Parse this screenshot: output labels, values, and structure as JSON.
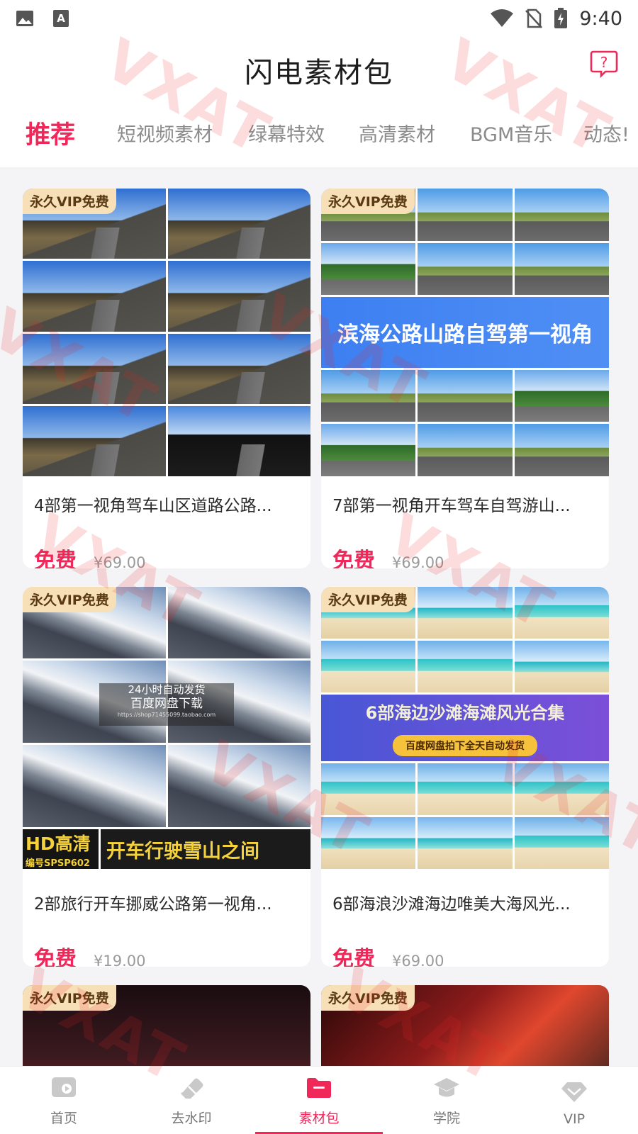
{
  "status_bar": {
    "time": "9:40",
    "icons": [
      "image-icon",
      "text-a-icon",
      "wifi-icon",
      "no-sim-icon",
      "battery-charging-icon"
    ]
  },
  "header": {
    "title": "闪电素材包",
    "help_icon": "question-bubble-icon"
  },
  "tabs": [
    {
      "label": "推荐",
      "active": true
    },
    {
      "label": "短视频素材",
      "active": false
    },
    {
      "label": "绿幕特效",
      "active": false
    },
    {
      "label": "高清素材",
      "active": false
    },
    {
      "label": "BGM音乐",
      "active": false
    },
    {
      "label": "动态!",
      "active": false
    }
  ],
  "cards": [
    {
      "badge": "永久VIP免费",
      "title": "4部第一视角驾车山区道路公路...",
      "price_label": "免费",
      "original_price": "¥69.00"
    },
    {
      "badge": "永久VIP免费",
      "banner_text": "滨海公路山路自驾第一视角",
      "title": "7部第一视角开车驾车自驾游山...",
      "price_label": "免费",
      "original_price": "¥69.00"
    },
    {
      "badge": "永久VIP免费",
      "overlay": [
        "24小时自动发货",
        "百度网盘下载",
        "https://shop71455099.taobao.com"
      ],
      "hd_big": "HD高清",
      "hd_code": "编号SPSP602",
      "hd_caption": "开车行驶雪山之间",
      "title": "2部旅行开车挪威公路第一视角...",
      "price_label": "免费",
      "original_price": "¥19.00"
    },
    {
      "badge": "永久VIP免费",
      "banner_text": "6部海边沙滩海滩风光合集",
      "banner_pill": "百度网盘拍下全天自动发货",
      "title": "6部海浪沙滩海边唯美大海风光...",
      "price_label": "免费",
      "original_price": "¥69.00"
    },
    {
      "badge": "永久VIP免费"
    },
    {
      "badge": "永久VIP免费"
    }
  ],
  "bottom_nav": [
    {
      "label": "首页",
      "icon": "home-video-icon",
      "active": false
    },
    {
      "label": "去水印",
      "icon": "eraser-icon",
      "active": false
    },
    {
      "label": "素材包",
      "icon": "folder-icon",
      "active": true
    },
    {
      "label": "学院",
      "icon": "graduation-cap-icon",
      "active": false
    },
    {
      "label": "VIP",
      "icon": "diamond-icon",
      "active": false
    }
  ],
  "watermark": "VXAT",
  "colors": {
    "accent": "#f0285a",
    "badge_bg": "#f7dfb8"
  }
}
